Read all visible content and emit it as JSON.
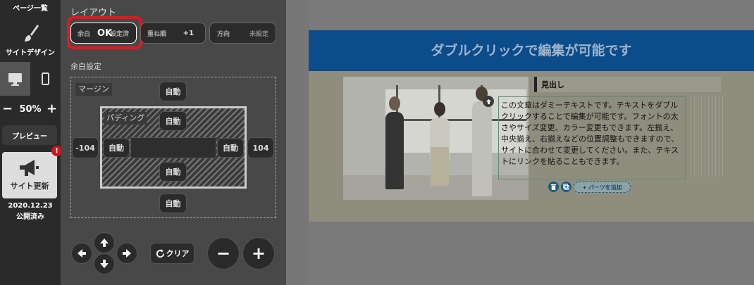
{
  "sidebar": {
    "pages_label": "ページ一覧",
    "design_label": "サイトデザイン",
    "zoom": "50%",
    "zoom_minus": "−",
    "zoom_plus": "+",
    "preview_label": "プレビュー",
    "update_label": "サイト更新",
    "update_badge": "!",
    "publish_date": "2020.12.23",
    "publish_status": "公開済み"
  },
  "panel": {
    "title": "レイアウト",
    "tabs": [
      {
        "label": "余白",
        "value": "設定済"
      },
      {
        "label": "重ね順",
        "value": "+1"
      },
      {
        "label": "方向",
        "value": "未設定"
      }
    ],
    "ok_overlay": "OK",
    "section_title": "余白設定",
    "margin_label": "マージン",
    "padding_label": "パディング",
    "auto": "自動",
    "margin_left_value": "-104",
    "margin_right_value": "104",
    "clear_label": "クリア",
    "minus_label": "−",
    "plus_label": "+"
  },
  "canvas": {
    "banner_title": "ダブルクリックで編集が可能です",
    "heading": "見出し",
    "body_text": "この文章はダミーテキストです。テキストをダブルクリックすることで編集が可能です。フォントの太さやサイズ変更、カラー変更もできます。左揃え、中央揃え、右揃えなどの位置調整もできますので、サイトに合わせて変更してください。また、テキストにリンクを貼ることもできます。",
    "add_parts_label": "パーツを追加"
  },
  "colors": {
    "highlight_red": "#e8141e",
    "banner_blue": "#0b4c8a"
  }
}
